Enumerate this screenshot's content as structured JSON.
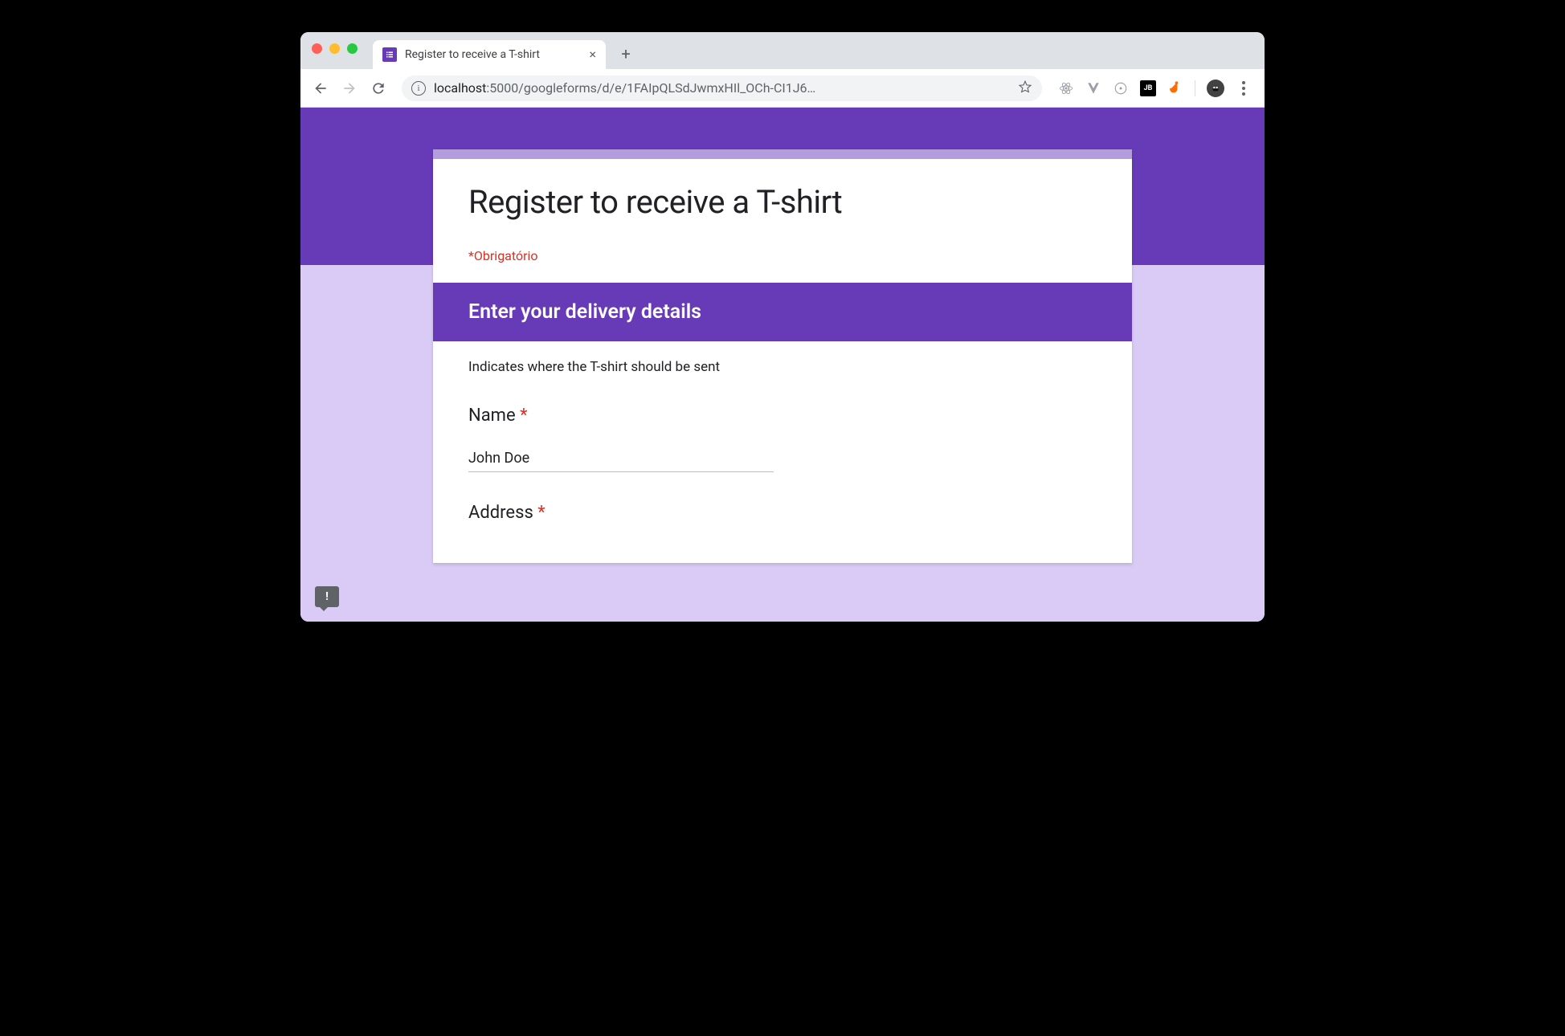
{
  "browser": {
    "tab_title": "Register to receive a T-shirt",
    "url_host": "localhost",
    "url_path": ":5000/googleforms/d/e/1FAIpQLSdJwmxHIl_OCh-CI1J6…",
    "extensions": {
      "jb_label": "JB"
    }
  },
  "form": {
    "title": "Register to receive a T-shirt",
    "required_note": "*Obrigatório",
    "section_title": "Enter your delivery details",
    "section_desc": "Indicates where the T-shirt should be sent",
    "fields": {
      "name": {
        "label": "Name",
        "value": "John Doe"
      },
      "address": {
        "label": "Address",
        "value": ""
      }
    },
    "required_mark": "*"
  },
  "feedback_mark": "!"
}
